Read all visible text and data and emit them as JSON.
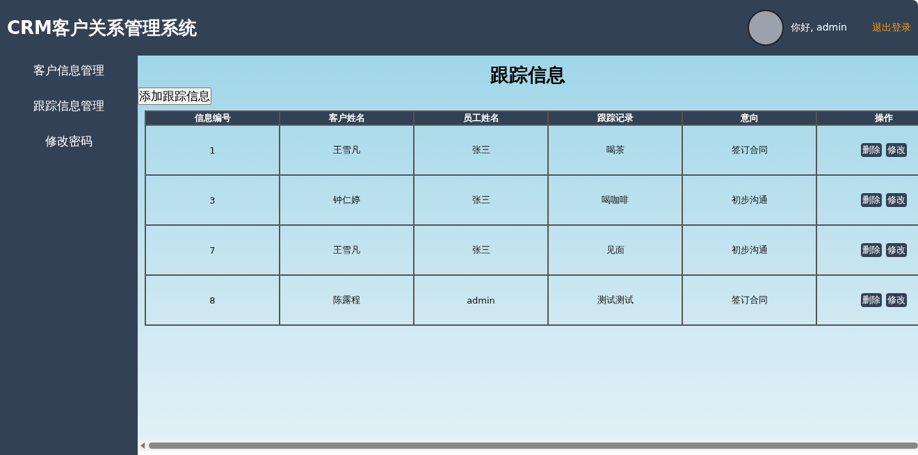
{
  "header": {
    "title": "CRM客户关系管理系统",
    "greeting": "你好, admin",
    "logout": "退出登录"
  },
  "sidebar": {
    "items": [
      {
        "label": "客户信息管理",
        "selected": false
      },
      {
        "label": "跟踪信息管理",
        "selected": false
      },
      {
        "label": "修改密码",
        "selected": false
      }
    ]
  },
  "page_title": "跟踪信息",
  "add_button": "添加跟踪信息",
  "table": {
    "columns": [
      "信息编号",
      "客户姓名",
      "员工姓名",
      "跟踪记录",
      "意向",
      "操作"
    ],
    "rows": [
      {
        "cells": [
          "1",
          "王雪凡",
          "张三",
          "喝茶",
          "签订合同"
        ],
        "actions": [
          "删除",
          "修改"
        ]
      },
      {
        "cells": [
          "3",
          "钟仁婷",
          "张三",
          "喝咖啡",
          "初步沟通"
        ],
        "actions": [
          "删除",
          "修改"
        ]
      },
      {
        "cells": [
          "7",
          "王雪凡",
          "张三",
          "见面",
          "初步沟通"
        ],
        "actions": [
          "删除",
          "修改"
        ]
      },
      {
        "cells": [
          "8",
          "陈露程",
          "admin",
          "测试测试",
          "签订合同"
        ],
        "actions": [
          "删除",
          "修改"
        ]
      }
    ]
  }
}
